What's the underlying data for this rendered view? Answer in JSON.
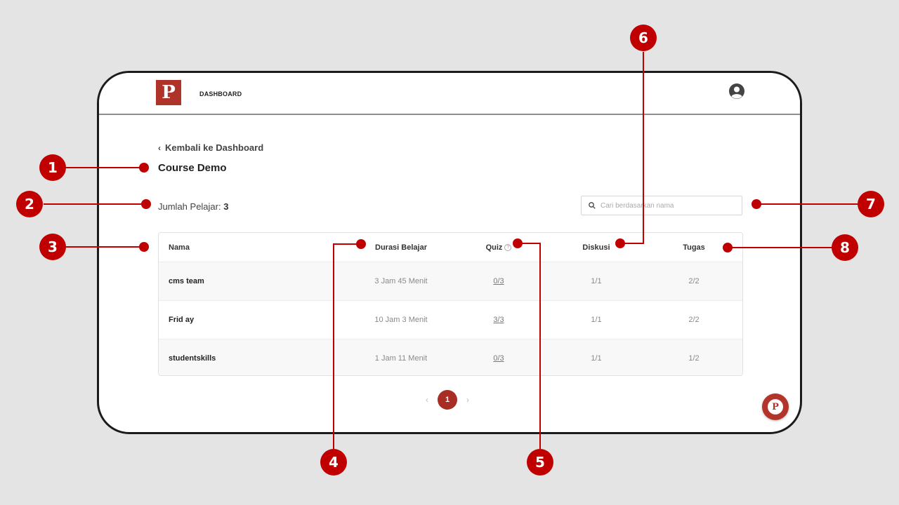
{
  "header": {
    "logo_letter": "P",
    "nav_label": "DASHBOARD",
    "avatar_icon": "user-avatar-icon"
  },
  "back_link": {
    "label": "Kembali ke Dashboard"
  },
  "course": {
    "title": "Course Demo"
  },
  "students": {
    "label": "Jumlah Pelajar:",
    "count": "3"
  },
  "search": {
    "placeholder": "Cari berdasarkan nama"
  },
  "table": {
    "columns": [
      "Nama",
      "Durasi Belajar",
      "Quiz",
      "Diskusi",
      "Tugas"
    ],
    "rows": [
      [
        "cms team",
        "3 Jam 45 Menit",
        "0/3",
        "1/1",
        "2/2"
      ],
      [
        "Frid ay",
        "10 Jam 3 Menit",
        "3/3",
        "1/1",
        "2/2"
      ],
      [
        "studentskills",
        "1 Jam 11 Menit",
        "0/3",
        "1/1",
        "1/2"
      ]
    ]
  },
  "pagination": {
    "current": "1"
  },
  "fab": {
    "letter": "P"
  },
  "annotations": [
    "1",
    "2",
    "3",
    "4",
    "5",
    "6",
    "7",
    "8"
  ],
  "colors": {
    "brand": "#b0332a",
    "annotation": "#c00000"
  }
}
